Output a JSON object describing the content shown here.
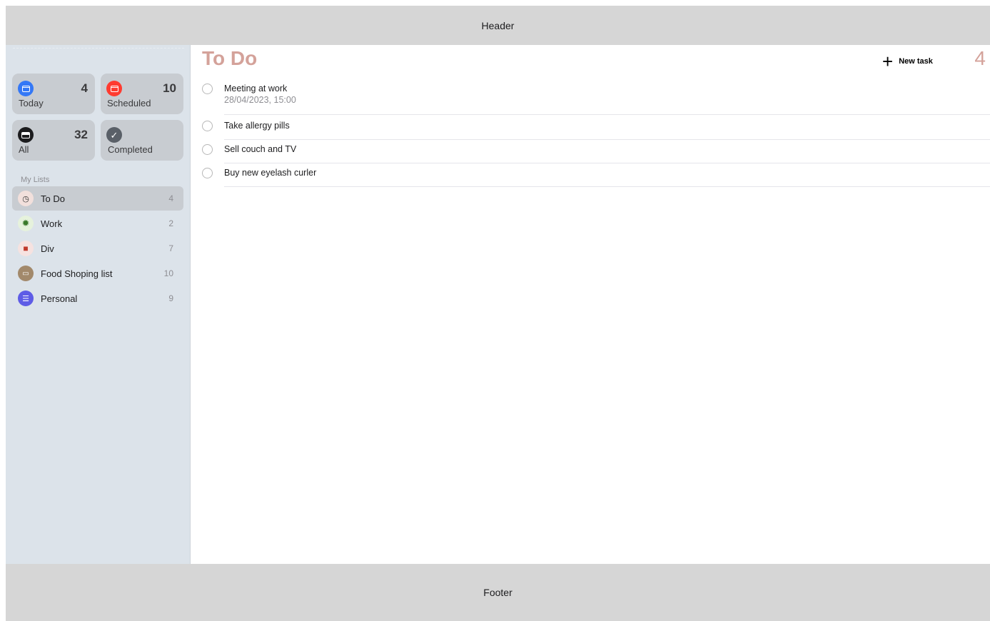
{
  "header": {
    "label": "Header"
  },
  "footer": {
    "label": "Footer"
  },
  "sidebar": {
    "cards": [
      {
        "label": "Today",
        "count": "4",
        "color": "#3478f6",
        "icon": "calendar-icon"
      },
      {
        "label": "Scheduled",
        "count": "10",
        "color": "#ff3b30",
        "icon": "calendar-icon"
      },
      {
        "label": "All",
        "count": "32",
        "color": "#1c1c1e",
        "icon": "tray-icon"
      },
      {
        "label": "Completed",
        "count": "",
        "color": "#5a6068",
        "icon": "checkmark-icon"
      }
    ],
    "my_lists_title": "My Lists",
    "lists": [
      {
        "label": "To Do",
        "count": "4",
        "color": "#f2e0dc",
        "icon": "clock-icon"
      },
      {
        "label": "Work",
        "count": "2",
        "color": "#e6f2dc",
        "icon": "gear-icon"
      },
      {
        "label": "Div",
        "count": "7",
        "color": "#f6e2e0",
        "icon": "gift-icon"
      },
      {
        "label": "Food Shoping list",
        "count": "10",
        "color": "#a2896b",
        "icon": "money-icon"
      },
      {
        "label": "Personal",
        "count": "9",
        "color": "#5e5ce6",
        "icon": "list-icon"
      }
    ]
  },
  "main": {
    "title": "To Do",
    "count": "4",
    "new_task_label": "New task",
    "accent": "#d4a29a",
    "tasks": [
      {
        "title": "Meeting at work",
        "date": "28/04/2023, 15:00"
      },
      {
        "title": "Take allergy pills",
        "date": ""
      },
      {
        "title": "Sell couch and TV",
        "date": ""
      },
      {
        "title": "Buy new eyelash curler",
        "date": ""
      }
    ]
  }
}
